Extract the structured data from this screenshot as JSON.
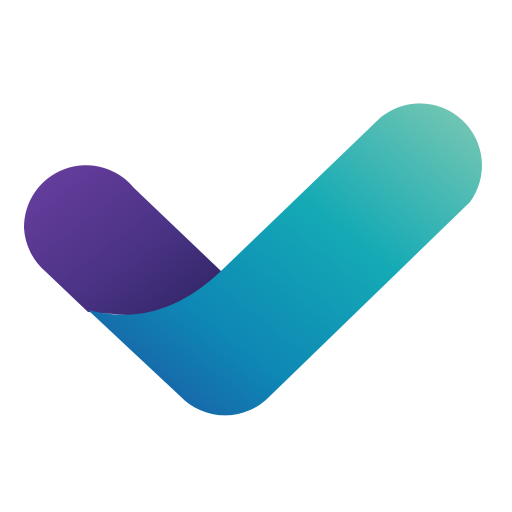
{
  "logo": {
    "icon": "checkmark-icon",
    "colors": {
      "short_stroke_start": "#6a3fa0",
      "short_stroke_mid": "#4b3386",
      "short_stroke_end": "#2e2462",
      "long_stroke_dark": "#1f4fa0",
      "long_stroke_mid": "#0e87b5",
      "long_stroke_teal": "#14aab5",
      "long_stroke_light": "#7ec9b2",
      "background": "#ffffff"
    }
  }
}
